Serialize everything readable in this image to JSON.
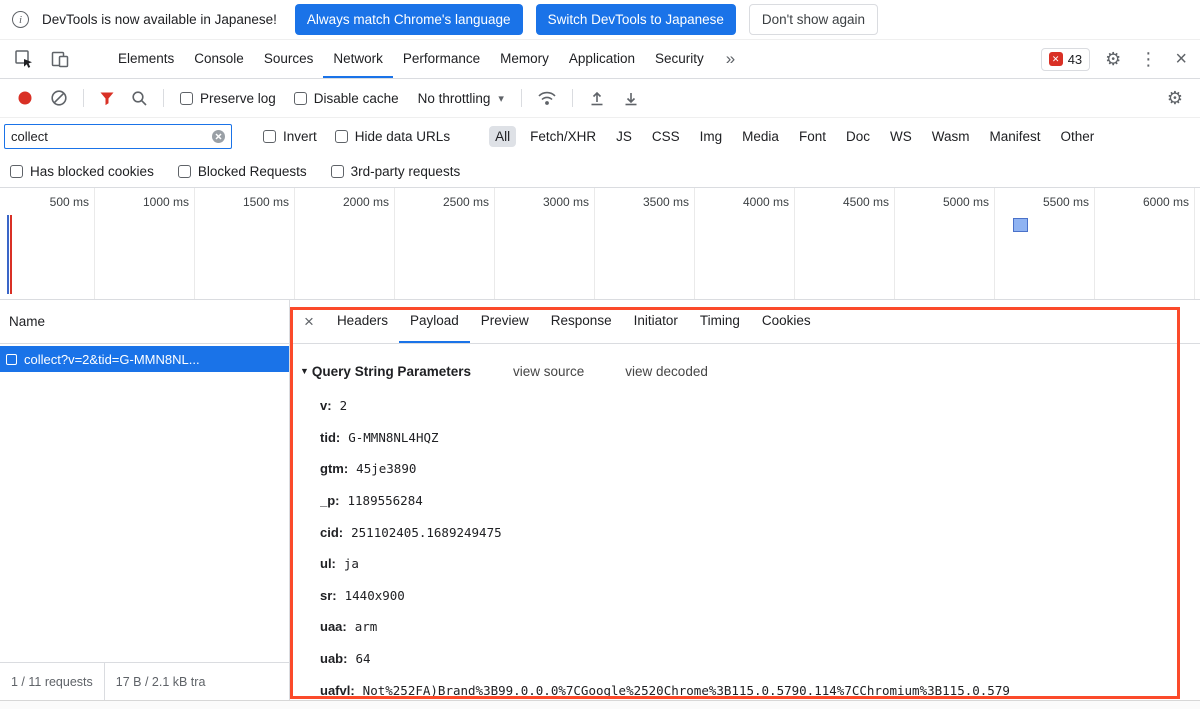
{
  "notification": {
    "message": "DevTools is now available in Japanese!",
    "primary_button": "Always match Chrome's language",
    "secondary_button": "Switch DevTools to Japanese",
    "dismiss_button": "Don't show again"
  },
  "tabbar": {
    "tabs": [
      "Elements",
      "Console",
      "Sources",
      "Network",
      "Performance",
      "Memory",
      "Application",
      "Security"
    ],
    "selected": "Network",
    "more_symbol": "»",
    "error_count": "43",
    "error_icon_glyph": "✕",
    "settings_glyph": "⚙",
    "menu_glyph": "⋮",
    "close_glyph": "×"
  },
  "toolbar": {
    "preserve_log_label": "Preserve log",
    "disable_cache_label": "Disable cache",
    "throttling_value": "No throttling",
    "caret_glyph": "▾"
  },
  "filters": {
    "search_value": "collect",
    "invert_label": "Invert",
    "hide_data_urls_label": "Hide data URLs",
    "types": [
      "All",
      "Fetch/XHR",
      "JS",
      "CSS",
      "Img",
      "Media",
      "Font",
      "Doc",
      "WS",
      "Wasm",
      "Manifest",
      "Other"
    ],
    "selected_type": "All",
    "has_blocked_cookies_label": "Has blocked cookies",
    "blocked_requests_label": "Blocked Requests",
    "third_party_label": "3rd-party requests"
  },
  "timeline": {
    "labels": [
      "500 ms",
      "1000 ms",
      "1500 ms",
      "2000 ms",
      "2500 ms",
      "3000 ms",
      "3500 ms",
      "4000 ms",
      "4500 ms",
      "5000 ms",
      "5500 ms",
      "6000 ms"
    ]
  },
  "requests": {
    "name_header": "Name",
    "selected_request": "collect?v=2&tid=G-MMN8NL...",
    "summary_requests": "1 / 11 requests",
    "summary_transferred": "17 B / 2.1 kB tra"
  },
  "detail": {
    "close_glyph": "×",
    "tabs": [
      "Headers",
      "Payload",
      "Preview",
      "Response",
      "Initiator",
      "Timing",
      "Cookies"
    ],
    "selected_tab": "Payload",
    "disclosure_glyph": "▼",
    "query_section_title": "Query String Parameters",
    "view_source_label": "view source",
    "view_decoded_label": "view decoded",
    "params": [
      {
        "key": "v:",
        "value": "2"
      },
      {
        "key": "tid:",
        "value": "G-MMN8NL4HQZ"
      },
      {
        "key": "gtm:",
        "value": "45je3890"
      },
      {
        "key": "_p:",
        "value": "1189556284"
      },
      {
        "key": "cid:",
        "value": "251102405.1689249475"
      },
      {
        "key": "ul:",
        "value": "ja"
      },
      {
        "key": "sr:",
        "value": "1440x900"
      },
      {
        "key": "uaa:",
        "value": "arm"
      },
      {
        "key": "uab:",
        "value": "64"
      },
      {
        "key": "uafvl:",
        "value": "Not%252FA)Brand%3B99.0.0.0%7CGoogle%2520Chrome%3B115.0.5790.114%7CChromium%3B115.0.579"
      }
    ]
  },
  "colors": {
    "accent_blue": "#1a73e8",
    "selection_blue": "#1a73e8",
    "record_red": "#d93025",
    "annotation_red": "#fb4a2a"
  }
}
